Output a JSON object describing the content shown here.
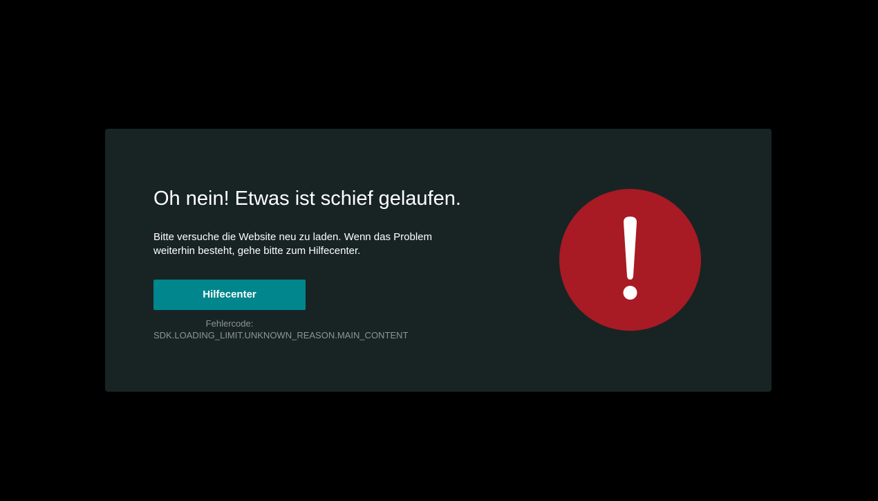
{
  "error": {
    "title": "Oh nein! Etwas ist schief gelaufen.",
    "message": "Bitte versuche die Website neu zu laden. Wenn das Problem weiterhin besteht, gehe bitte zum Hilfecenter.",
    "help_button_label": "Hilfecenter",
    "code_label": "Fehlercode:",
    "code_value": "SDK.LOADING_LIMIT.UNKNOWN_REASON.MAIN_CONTENT",
    "icon": "exclamation-icon"
  },
  "colors": {
    "page_background": "#000000",
    "card_background": "#182424",
    "button": "#00868c",
    "alert": "#a81a24",
    "muted_text": "#8e9494"
  }
}
